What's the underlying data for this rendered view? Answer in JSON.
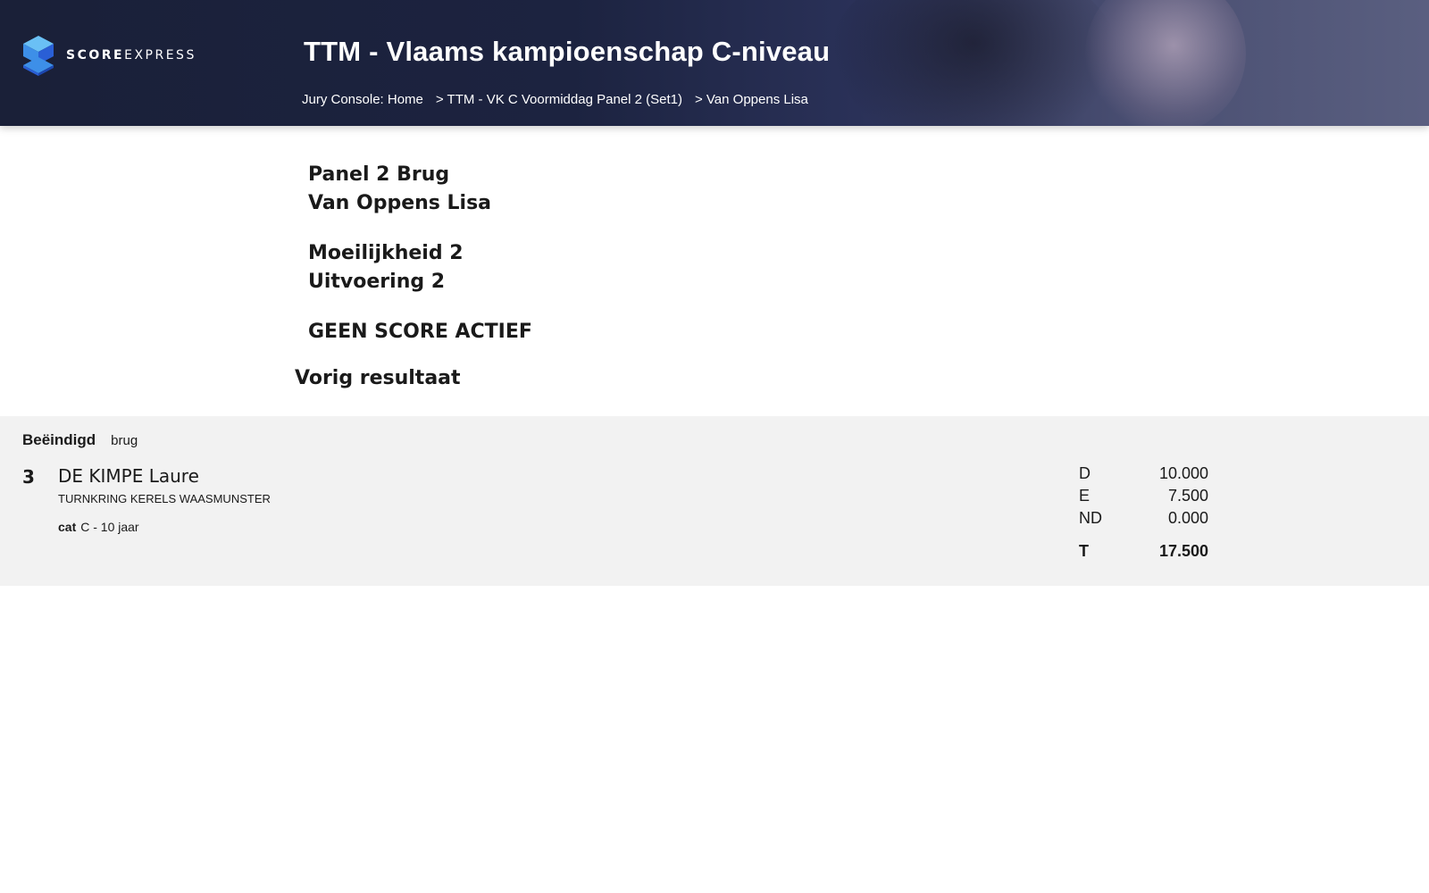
{
  "brand": {
    "name_bold": "SCORE",
    "name_rest": "EXPRESS",
    "primary_color": "#1c2340",
    "logo_colors": [
      "#3d8fe8",
      "#2a5fd6",
      "#6ac0f5"
    ]
  },
  "header": {
    "title": "TTM - Vlaams kampioenschap C-niveau",
    "breadcrumb": [
      "Jury Console: Home",
      "> TTM - VK C Voormiddag Panel 2 (Set1)",
      "> Van Oppens Lisa"
    ]
  },
  "panel": {
    "panel_name": "Panel 2 Brug",
    "gymnast": "Van Oppens Lisa",
    "difficulty": "Moeilijkheid 2",
    "execution": "Uitvoering 2",
    "score_status": "GEEN SCORE ACTIEF"
  },
  "previous": {
    "heading": "Vorig resultaat",
    "status": "Beëindigd",
    "apparatus": "brug",
    "rank": "3",
    "athlete": "DE KIMPE Laure",
    "club": "TURNKRING KERELS WAASMUNSTER",
    "category_label": "cat",
    "category": "C - 10 jaar",
    "scores": [
      {
        "label": "D",
        "value": "10.000"
      },
      {
        "label": "E",
        "value": "7.500"
      },
      {
        "label": "ND",
        "value": "0.000"
      }
    ],
    "total": {
      "label": "T",
      "value": "17.500"
    }
  }
}
